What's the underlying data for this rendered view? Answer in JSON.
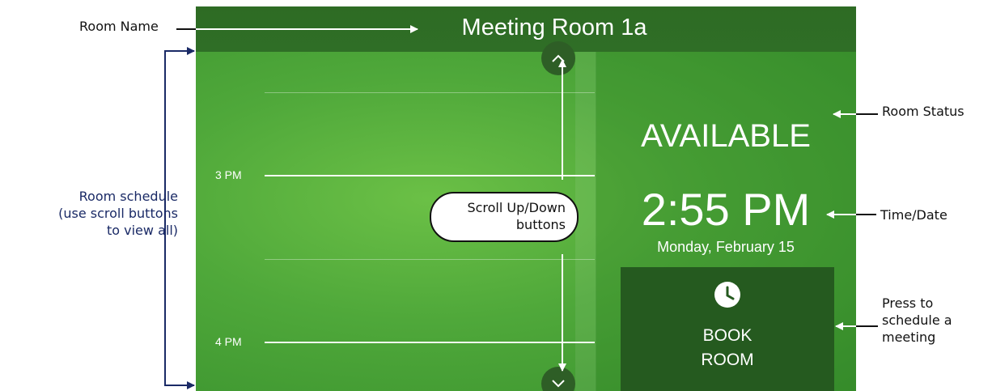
{
  "panel": {
    "room_name": "Meeting Room 1a",
    "status": "AVAILABLE",
    "time": "2:55 PM",
    "date": "Monday, February 15",
    "book_button": "BOOK\nROOM",
    "schedule": {
      "time_labels": [
        "3 PM",
        "4 PM"
      ]
    },
    "scroll_up_icon": "chevron-up-icon",
    "scroll_down_icon": "chevron-down-icon",
    "book_icon": "clock-icon"
  },
  "annotations": {
    "room_name": "Room Name",
    "room_status": "Room Status",
    "time_date": "Time/Date",
    "schedule_line1": "Room schedule",
    "schedule_line2": "(use scroll buttons",
    "schedule_line3": "to view all)",
    "scroll_line1": "Scroll Up/Down",
    "scroll_line2": "buttons",
    "book_line1": "Press to",
    "book_line2": "schedule a",
    "book_line3": "meeting"
  },
  "colors": {
    "panel_green": "#4fa83a",
    "header_green": "#2e6b24",
    "button_green": "#255a1f",
    "annotation_blue": "#1a2a66"
  }
}
